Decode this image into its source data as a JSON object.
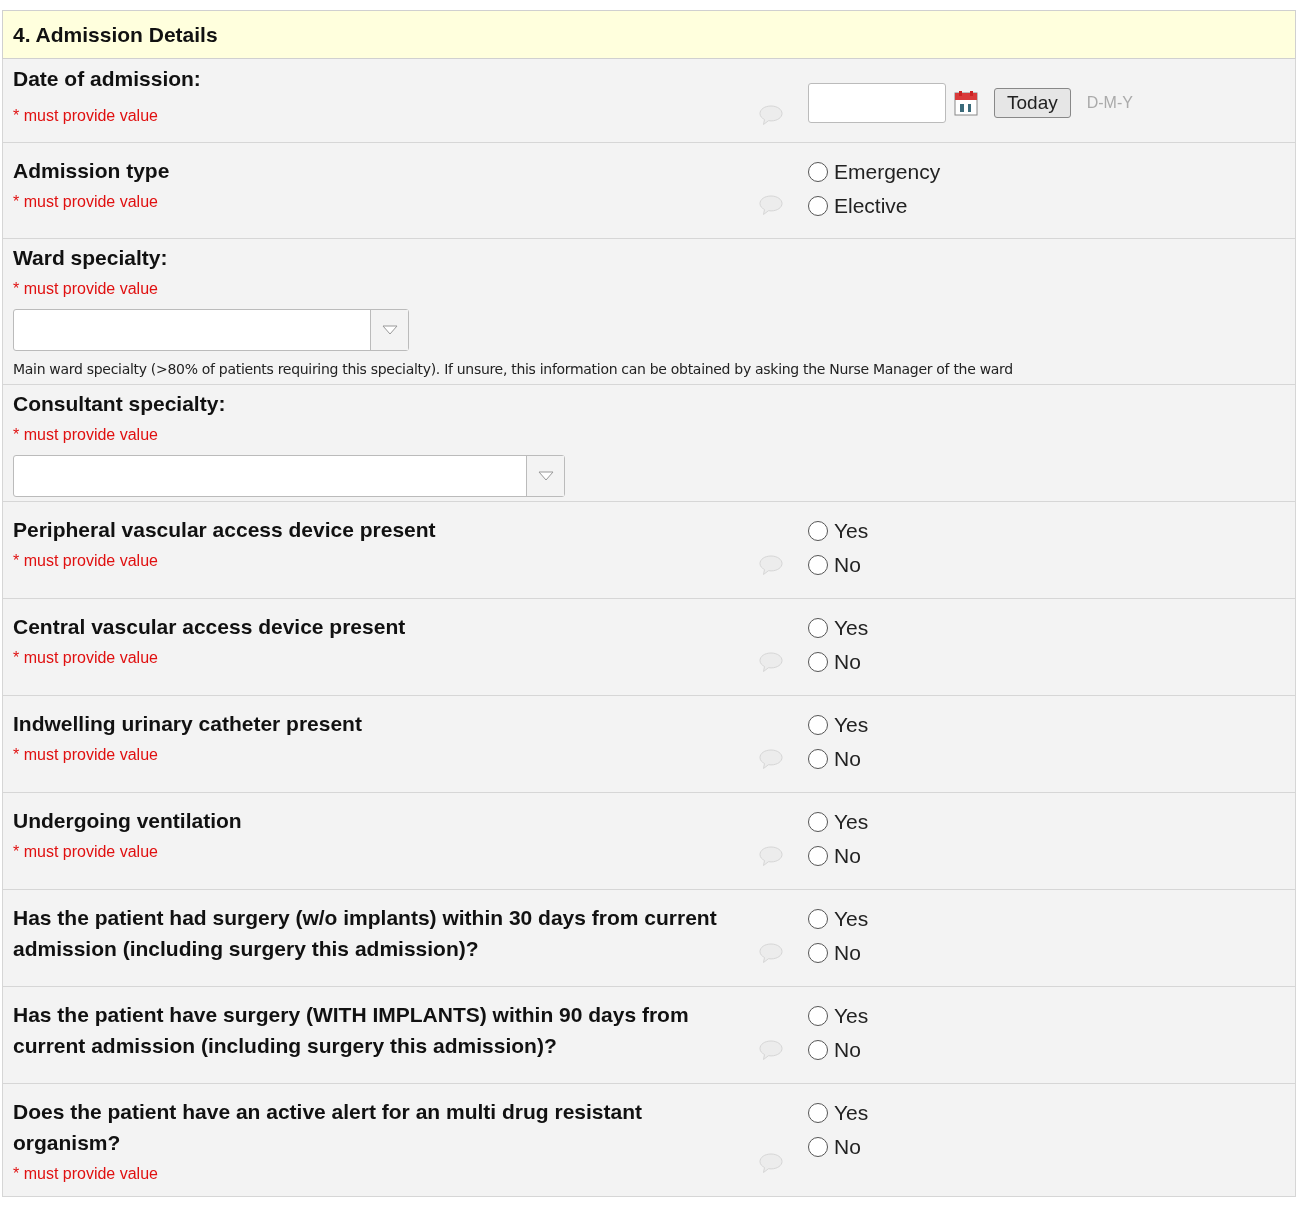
{
  "section": {
    "title": "4. Admission Details"
  },
  "fields": [
    {
      "kind": "date",
      "label": "Date of admission:",
      "required": "* must provide value",
      "button": "Today",
      "format": "D-M-Y"
    },
    {
      "kind": "radio",
      "label": "Admission type",
      "required": "* must provide value",
      "options": [
        {
          "label": "Emergency",
          "selected": false
        },
        {
          "label": "Elective",
          "selected": false
        }
      ]
    },
    {
      "kind": "dropdown",
      "label": "Ward specialty:",
      "required": "* must provide value",
      "note": "Main ward specialty (>80% of patients requiring this specialty). If unsure, this information can be obtained by asking the Nurse Manager of the ward",
      "wide": false
    },
    {
      "kind": "dropdown",
      "label": "Consultant specialty:",
      "required": "* must provide value",
      "wide": true
    },
    {
      "kind": "radio",
      "label": "Peripheral vascular access device present",
      "required": "* must provide value",
      "options": [
        {
          "label": "Yes",
          "selected": false
        },
        {
          "label": "No",
          "selected": false
        }
      ]
    },
    {
      "kind": "radio",
      "label": "Central vascular access device present",
      "required": "* must provide value",
      "options": [
        {
          "label": "Yes",
          "selected": false
        },
        {
          "label": "No",
          "selected": false
        }
      ]
    },
    {
      "kind": "radio",
      "label": "Indwelling urinary catheter present",
      "required": "* must provide value",
      "options": [
        {
          "label": "Yes",
          "selected": false
        },
        {
          "label": "No",
          "selected": false
        }
      ]
    },
    {
      "kind": "radio",
      "label": "Undergoing ventilation",
      "required": "* must provide value",
      "options": [
        {
          "label": "Yes",
          "selected": false
        },
        {
          "label": "No",
          "selected": false
        }
      ]
    },
    {
      "kind": "radio",
      "label": "Has the patient had surgery (w/o implants) within 30 days from current admission (including surgery this admission)?",
      "options": [
        {
          "label": "Yes",
          "selected": false
        },
        {
          "label": "No",
          "selected": false
        }
      ]
    },
    {
      "kind": "radio",
      "label": "Has the patient have surgery (WITH IMPLANTS) within 90 days from current admission (including surgery this admission)?",
      "options": [
        {
          "label": "Yes",
          "selected": false
        },
        {
          "label": "No",
          "selected": false
        }
      ]
    },
    {
      "kind": "radio",
      "label": "Does the patient have an active alert for an multi drug resistant organism?",
      "required": "* must provide value",
      "options": [
        {
          "label": "Yes",
          "selected": false
        },
        {
          "label": "No",
          "selected": false
        }
      ]
    }
  ]
}
